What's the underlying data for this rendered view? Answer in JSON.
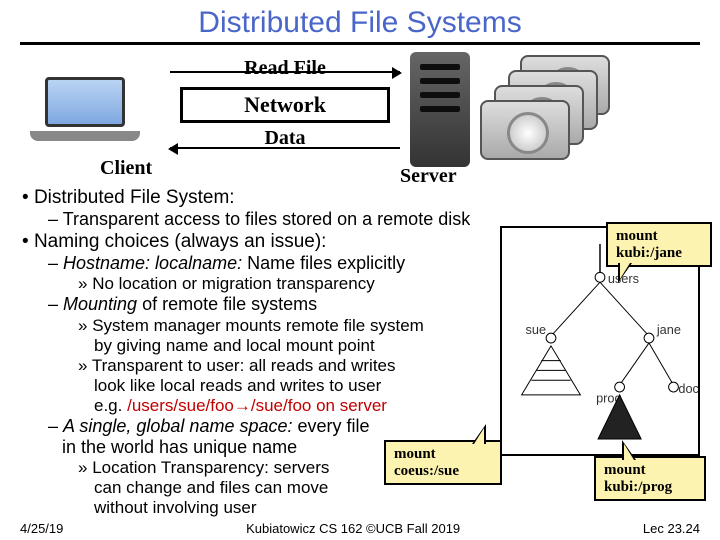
{
  "title": "Distributed File Systems",
  "diagram": {
    "read": "Read File",
    "network": "Network",
    "data": "Data",
    "client": "Client",
    "server": "Server"
  },
  "bullets": {
    "dfs": "Distributed File System:",
    "dfs_sub": "Transparent access to files stored on a remote disk",
    "naming": "Naming choices (always an issue):",
    "hostname": "Hostname: localname:",
    "hostname_tail": " Name files explicitly",
    "nolocation": "No location or migration transparency",
    "mounting": "Mounting",
    "mounting_tail": " of remote file systems",
    "sysmgr1": "System manager mounts remote file system",
    "sysmgr2": "by giving name and local mount point",
    "transp1": "Transparent to user: all reads and writes",
    "transp2": "look like local reads and writes to user",
    "eg_pre": "e.g. ",
    "eg_path_left": "/users/sue/foo",
    "eg_arrow": "→",
    "eg_path_right": "/sue/foo",
    "eg_suffix": " on server",
    "global": "A single, global name space:",
    "global_tail": " every file",
    "global_line2": "in the world has unique name",
    "loctrans1": "Location Transparency: servers",
    "loctrans2": "can change and files can move",
    "loctrans3": "without involving user"
  },
  "tree": {
    "root": "/",
    "users": "users",
    "sue": "sue",
    "jane": "jane",
    "prog": "prog",
    "doc": "doc"
  },
  "callouts": {
    "c1a": "mount",
    "c1b": "kubi:/jane",
    "c2a": "mount",
    "c2b": "coeus:/sue",
    "c3a": "mount",
    "c3b": "kubi:/prog"
  },
  "footer": {
    "left": "4/25/19",
    "center": "Kubiatowicz CS 162 ©UCB Fall 2019",
    "right": "Lec 23.24"
  }
}
